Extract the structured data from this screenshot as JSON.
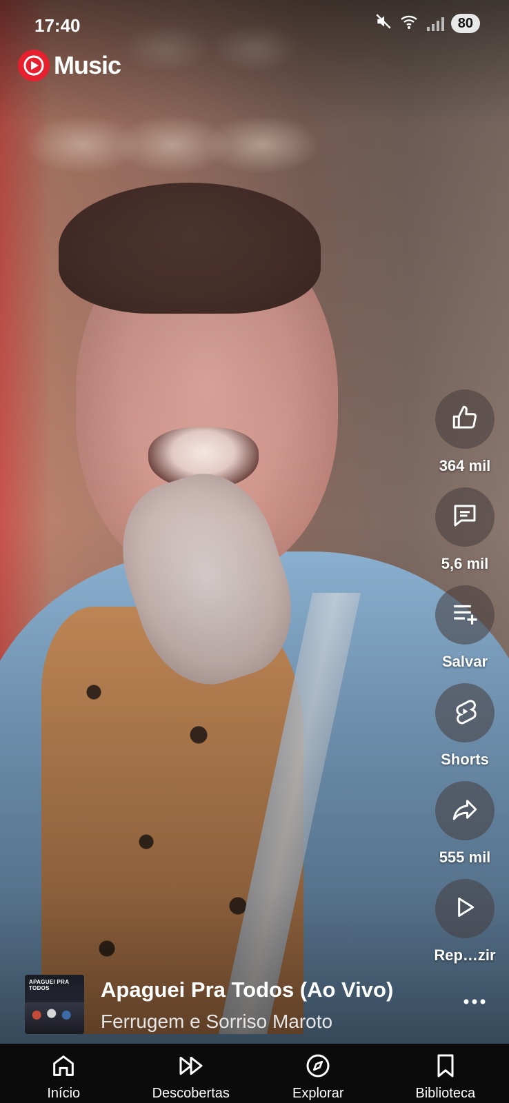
{
  "status_bar": {
    "time": "17:40",
    "battery": "80"
  },
  "app": {
    "logo_text": "Music"
  },
  "actions": {
    "like": {
      "label": "364 mil",
      "icon": "thumb-up-icon"
    },
    "comments": {
      "label": "5,6 mil",
      "icon": "comment-icon"
    },
    "save": {
      "label": "Salvar",
      "icon": "playlist-add-icon"
    },
    "shorts": {
      "label": "Shorts",
      "icon": "shorts-icon"
    },
    "share": {
      "label": "555 mil",
      "icon": "share-icon"
    },
    "play": {
      "label": "Rep…zir",
      "icon": "play-icon"
    }
  },
  "now_playing": {
    "title": "Apaguei Pra Todos (Ao Vivo)",
    "artist": "Ferrugem e Sorriso Maroto",
    "album_art_title": "APAGUEI PRA TODOS"
  },
  "nav": {
    "home": "Início",
    "discover": "Descobertas",
    "explore": "Explorar",
    "library": "Biblioteca"
  },
  "colors": {
    "brand_red": "#e7202f",
    "nav_bg": "#0b0b0b"
  }
}
